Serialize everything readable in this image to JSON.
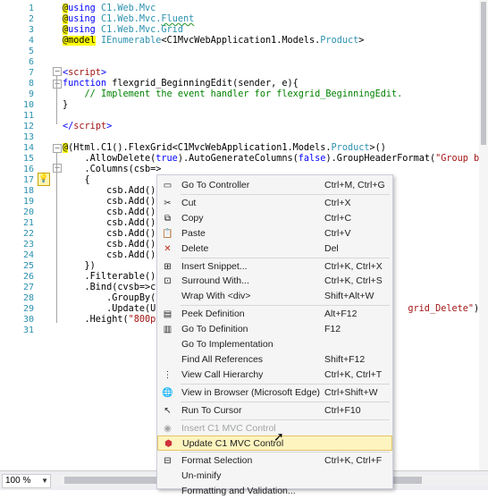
{
  "editor": {
    "lines": [
      {
        "n": "1",
        "html": "<span class='at'>@</span><span class='kw'>using</span> <span class='ty'>C1.Web.Mvc</span>"
      },
      {
        "n": "2",
        "html": "<span class='at'>@</span><span class='kw'>using</span> <span class='ty'>C1.Web.Mvc.</span><span class='ty sq'>Fluent</span>"
      },
      {
        "n": "3",
        "html": "<span class='at'>@</span><span class='kw'>using</span> <span class='ty'>C1.Web.Mvc.Grid</span>"
      },
      {
        "n": "4",
        "html": "<span class='at'>@model</span> <span class='ty'>IEnumerable</span>&lt;C1MvcWebApplication1.Models.<span class='ty'>Product</span>&gt;"
      },
      {
        "n": "5",
        "html": ""
      },
      {
        "n": "6",
        "html": ""
      },
      {
        "n": "7",
        "html": "<span class='br'>&lt;</span><span class='tag'>script</span><span class='br'>&gt;</span>"
      },
      {
        "n": "8",
        "html": "<span class='kw'>function</span> flexgrid_BeginningEdit(sender, e){"
      },
      {
        "n": "9",
        "html": "    <span class='cm'>// Implement the event handler for flexgrid_BeginningEdit.</span>"
      },
      {
        "n": "10",
        "html": "}"
      },
      {
        "n": "11",
        "html": ""
      },
      {
        "n": "12",
        "html": "<span class='br'>&lt;/</span><span class='tag'>script</span><span class='br'>&gt;</span>"
      },
      {
        "n": "13",
        "html": ""
      },
      {
        "n": "14",
        "html": "<span class='at'>@</span>(Html.C1().FlexGrid&lt;C1MvcWebApplication1.Models.<span class='ty'>Product</span>&gt;()"
      },
      {
        "n": "15",
        "html": "    .AllowDelete(<span class='kw'>true</span>).AutoGenerateColumns(<span class='kw'>false</span>).GroupHeaderFormat(<span class='str'>\"Group by Category ID\"</span>)"
      },
      {
        "n": "16",
        "html": "    .Columns(csb=&gt;"
      },
      {
        "n": "17",
        "html": "    {"
      },
      {
        "n": "18",
        "html": "        csb.Add().Bi"
      },
      {
        "n": "19",
        "html": "        csb.Add().Bi"
      },
      {
        "n": "20",
        "html": "        csb.Add().Bi"
      },
      {
        "n": "21",
        "html": "        csb.Add().Bi"
      },
      {
        "n": "22",
        "html": "        csb.Add().Bi"
      },
      {
        "n": "23",
        "html": "        csb.Add().Bi"
      },
      {
        "n": "24",
        "html": "        csb.Add().Bi"
      },
      {
        "n": "25",
        "html": "    })"
      },
      {
        "n": "26",
        "html": "    .Filterable()"
      },
      {
        "n": "27",
        "html": "    .Bind(cvsb=&gt;cvsb"
      },
      {
        "n": "28",
        "html": "        .GroupBy(<span class='str'>\"Ca</span>"
      },
      {
        "n": "29",
        "html": "        .Update(Url.A                                          <span class='str'>grid_Delete\"</span>)).Bind(M"
      },
      {
        "n": "30",
        "html": "    .Height(<span class='str'>\"800px\"</span>)"
      },
      {
        "n": "31",
        "html": ""
      }
    ]
  },
  "status": {
    "zoom": "100 %"
  },
  "menu": {
    "items": [
      {
        "icon": "▭",
        "icon_name": "goto-controller-icon",
        "label": "Go To Controller",
        "shortcut": "Ctrl+M, Ctrl+G",
        "sep_after": true,
        "disabled": false
      },
      {
        "icon": "✂",
        "icon_name": "cut-icon",
        "label": "Cut",
        "shortcut": "Ctrl+X",
        "sep_after": false,
        "disabled": false
      },
      {
        "icon": "⧉",
        "icon_name": "copy-icon",
        "label": "Copy",
        "shortcut": "Ctrl+C",
        "sep_after": false,
        "disabled": false
      },
      {
        "icon": "📋",
        "icon_name": "paste-icon",
        "label": "Paste",
        "shortcut": "Ctrl+V",
        "sep_after": false,
        "disabled": false
      },
      {
        "icon": "✕",
        "icon_name": "delete-icon",
        "label": "Delete",
        "shortcut": "Del",
        "sep_after": true,
        "disabled": false
      },
      {
        "icon": "⊞",
        "icon_name": "insert-snippet-icon",
        "label": "Insert Snippet...",
        "shortcut": "Ctrl+K, Ctrl+X",
        "sep_after": false,
        "disabled": false
      },
      {
        "icon": "⊡",
        "icon_name": "surround-with-icon",
        "label": "Surround With...",
        "shortcut": "Ctrl+K, Ctrl+S",
        "sep_after": false,
        "disabled": false
      },
      {
        "icon": "",
        "icon_name": "",
        "label": "Wrap With <div>",
        "shortcut": "Shift+Alt+W",
        "sep_after": true,
        "disabled": false
      },
      {
        "icon": "▤",
        "icon_name": "peek-definition-icon",
        "label": "Peek Definition",
        "shortcut": "Alt+F12",
        "sep_after": false,
        "disabled": false
      },
      {
        "icon": "▥",
        "icon_name": "goto-definition-icon",
        "label": "Go To Definition",
        "shortcut": "F12",
        "sep_after": false,
        "disabled": false
      },
      {
        "icon": "",
        "icon_name": "",
        "label": "Go To Implementation",
        "shortcut": "",
        "sep_after": false,
        "disabled": false
      },
      {
        "icon": "",
        "icon_name": "",
        "label": "Find All References",
        "shortcut": "Shift+F12",
        "sep_after": false,
        "disabled": false
      },
      {
        "icon": "⋮",
        "icon_name": "call-hierarchy-icon",
        "label": "View Call Hierarchy",
        "shortcut": "Ctrl+K, Ctrl+T",
        "sep_after": true,
        "disabled": false
      },
      {
        "icon": "🌐",
        "icon_name": "browser-icon",
        "label": "View in Browser (Microsoft Edge)",
        "shortcut": "Ctrl+Shift+W",
        "sep_after": true,
        "disabled": false
      },
      {
        "icon": "↖",
        "icon_name": "run-to-cursor-icon",
        "label": "Run To Cursor",
        "shortcut": "Ctrl+F10",
        "sep_after": true,
        "disabled": false
      },
      {
        "icon": "◉",
        "icon_name": "c1-insert-icon",
        "label": "Insert C1 MVC Control",
        "shortcut": "",
        "sep_after": false,
        "disabled": true
      },
      {
        "icon": "⬢",
        "icon_name": "c1-update-icon",
        "label": "Update C1 MVC Control",
        "shortcut": "",
        "sep_after": true,
        "disabled": false,
        "highlight": true
      },
      {
        "icon": "⊟",
        "icon_name": "format-selection-icon",
        "label": "Format Selection",
        "shortcut": "Ctrl+K, Ctrl+F",
        "sep_after": false,
        "disabled": false
      },
      {
        "icon": "",
        "icon_name": "",
        "label": "Un-minify",
        "shortcut": "",
        "sep_after": false,
        "disabled": false
      },
      {
        "icon": "",
        "icon_name": "",
        "label": "Formatting and Validation...",
        "shortcut": "",
        "sep_after": false,
        "disabled": false
      }
    ]
  }
}
